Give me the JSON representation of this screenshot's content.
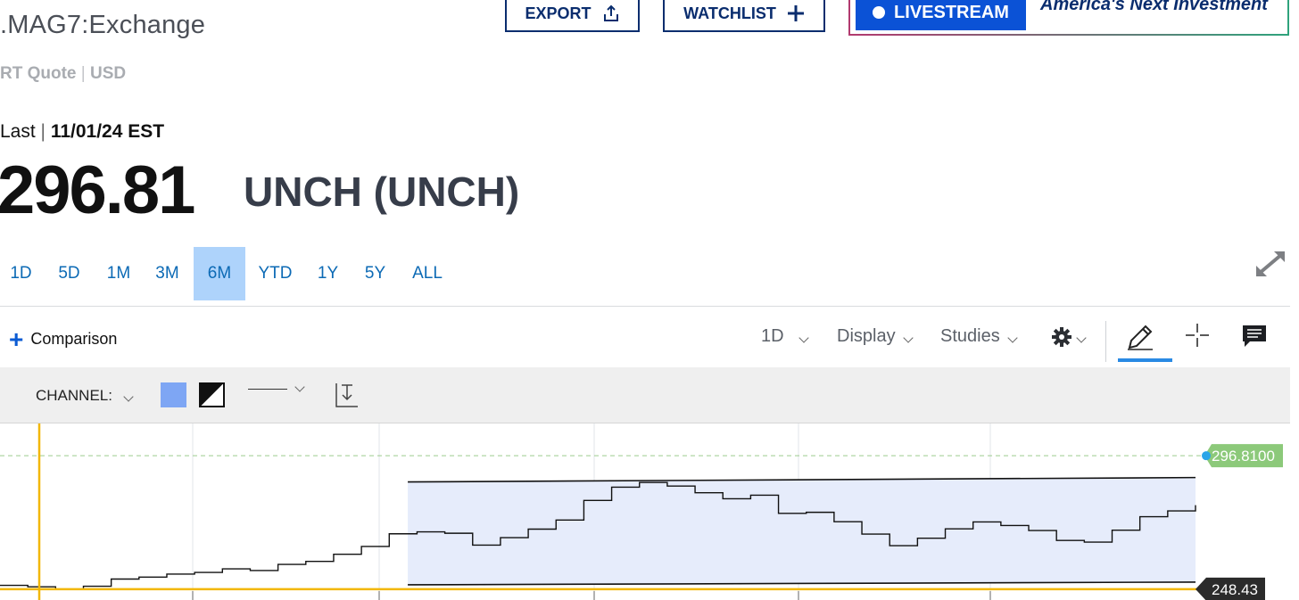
{
  "header": {
    "symbol": ".MAG7:Exchange",
    "quote_type": "RT Quote",
    "currency": "USD",
    "last_label": "Last",
    "last_date": "11/01/24 EST",
    "price": "296.81",
    "change": "UNCH (UNCH)",
    "export_label": "EXPORT",
    "watchlist_label": "WATCHLIST",
    "livestream_label": "LIVESTREAM",
    "promo_text": "America's Next Investment"
  },
  "ranges": [
    {
      "label": "1D",
      "active": false
    },
    {
      "label": "5D",
      "active": false
    },
    {
      "label": "1M",
      "active": false
    },
    {
      "label": "3M",
      "active": false
    },
    {
      "label": "6M",
      "active": true
    },
    {
      "label": "YTD",
      "active": false
    },
    {
      "label": "1Y",
      "active": false
    },
    {
      "label": "5Y",
      "active": false
    },
    {
      "label": "ALL",
      "active": false
    }
  ],
  "toolbar": {
    "comparison_label": "Comparison",
    "interval_label": "1D",
    "display_label": "Display",
    "studies_label": "Studies"
  },
  "drawing_toolbar": {
    "tool_label": "CHANNEL:",
    "fill_color": "#7ea6f4"
  },
  "colors": {
    "accent": "#0c6ab5",
    "active_range_bg": "#aed3fb",
    "crosshair": "#f2b705",
    "last_price_badge": "#8cc97a",
    "channel_fill": "#e6ecfb"
  },
  "chart_data": {
    "type": "line",
    "last_price_label": "296.8100",
    "crosshair_price_label": "248.43",
    "last_price": 296.81,
    "crosshair_price": 248.43,
    "ylim": [
      244.5,
      308.5
    ],
    "x": [
      0,
      3,
      6,
      9,
      12,
      15,
      18,
      21,
      24,
      27,
      30,
      33,
      36,
      39,
      42,
      45,
      48,
      51,
      54,
      57,
      60,
      63,
      66,
      69,
      72,
      75,
      78,
      81,
      84,
      87,
      90,
      93,
      96,
      99,
      102,
      105,
      108,
      111,
      114,
      117,
      120,
      123,
      126,
      129
    ],
    "values": [
      249.8,
      249.3,
      248.4,
      249.5,
      252.1,
      252.8,
      253.9,
      254.5,
      255.8,
      255.2,
      257.4,
      258.5,
      261.1,
      263.9,
      268.5,
      269.2,
      268.7,
      264.4,
      267.1,
      270.2,
      273.5,
      280.6,
      285.4,
      287.1,
      285.8,
      283.4,
      281.2,
      282.5,
      275.9,
      276.3,
      272.9,
      268.4,
      264.2,
      266.9,
      270.3,
      272.8,
      271.5,
      269.7,
      266.1,
      265.5,
      269.8,
      274.7,
      276.8,
      278.9
    ],
    "channel": {
      "x_start": 44,
      "x_end": 129,
      "upper": [
        287.3,
        288.9
      ],
      "lower": [
        250.0,
        251.0
      ]
    }
  }
}
